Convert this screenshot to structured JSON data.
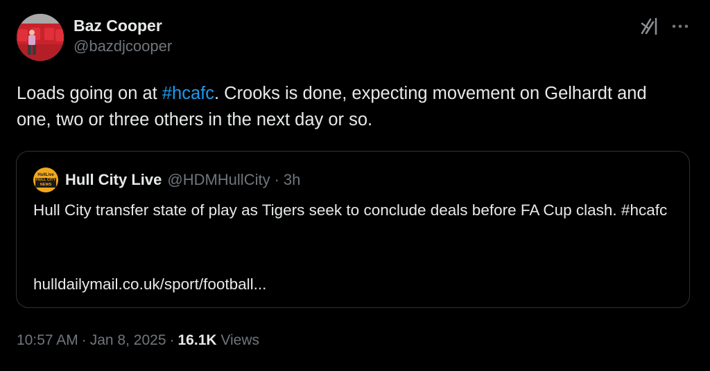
{
  "author": {
    "display_name": "Baz Cooper",
    "handle": "@bazdjcooper"
  },
  "icons": {
    "grok": "grok-icon",
    "more": "more-options-icon",
    "avatar": "profile-photo"
  },
  "tweet": {
    "text_before": "Loads going on at ",
    "hashtag": "#hcafc",
    "text_after": ". Crooks is done, expecting movement on Gelhardt and one, two or three others in the next day or so."
  },
  "quote": {
    "avatar_top": "HullLive",
    "avatar_box_line1": "HULL CITY",
    "avatar_box_line2": "NEWS",
    "name": "Hull City Live",
    "handle": "@HDMHullCity",
    "separator": "·",
    "time": "3h",
    "text": "Hull City transfer state of play as Tigers seek to conclude deals before FA Cup clash. #hcafc",
    "link": "hulldailymail.co.uk/sport/football..."
  },
  "meta": {
    "time": "10:57 AM",
    "date": "Jan 8, 2025",
    "separator": "·",
    "views_count": "16.1K",
    "views_label": "Views"
  },
  "colors": {
    "background": "#000000",
    "text": "#e7e9ea",
    "secondary": "#71767b",
    "link": "#1d9bf0",
    "border": "#2f3336",
    "quote_avatar": "#f2a81d"
  }
}
